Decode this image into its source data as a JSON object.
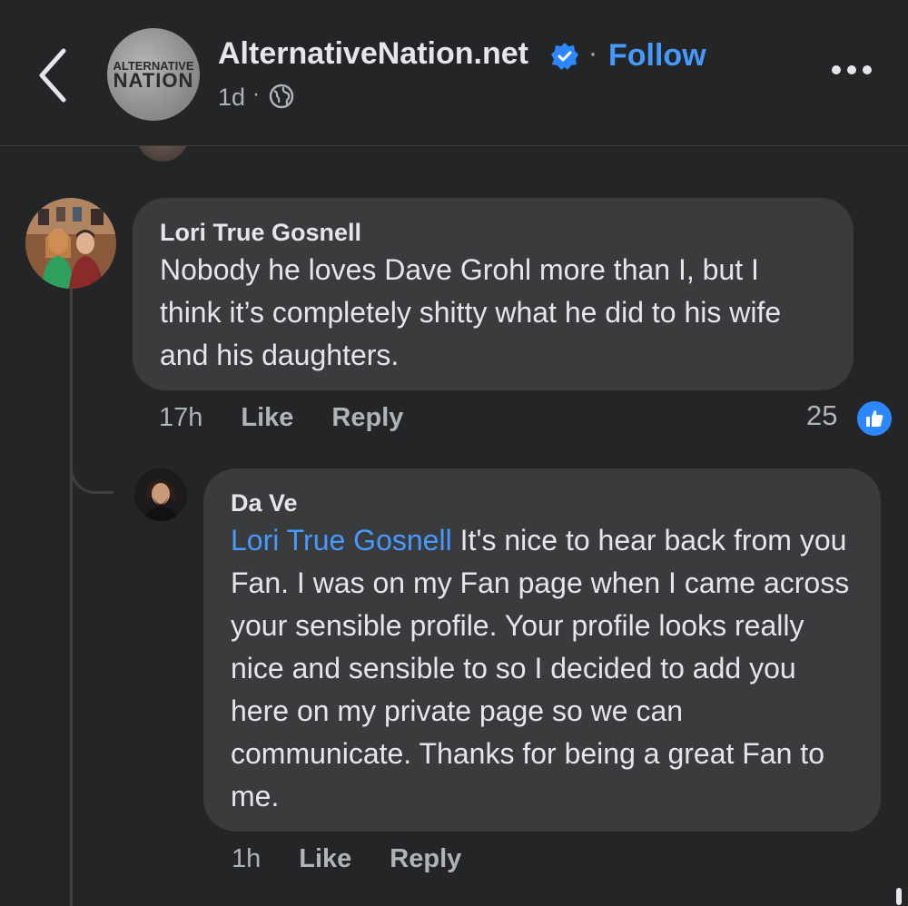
{
  "header": {
    "page_name": "AlternativeNation.net",
    "separator": "·",
    "follow_label": "Follow",
    "time": "1d",
    "meta_separator": "·",
    "logo_line1": "ALTERNATIVE",
    "logo_line2": "NATION",
    "icons": [
      "back-chevron-icon",
      "verified-badge-icon",
      "globe-icon",
      "more-options-icon"
    ]
  },
  "comments": [
    {
      "author": "Lori True Gosnell",
      "text": "Nobody he loves Dave Grohl more than I, but I think it’s completely shitty what he did to his wife and his daughters.",
      "time": "17h",
      "like_label": "Like",
      "reply_label": "Reply",
      "reaction_count": "25",
      "reaction_icon": "thumbs-up-icon"
    }
  ],
  "replies": [
    {
      "author": "Da Ve",
      "mention": "Lori True Gosnell",
      "text": " It's nice to hear back from you Fan. I was on my Fan page when I came across your sensible profile. Your profile looks really nice and sensible to so I decided to add you here on my private page so we can communicate. Thanks for being a great Fan to me.",
      "time": "1h",
      "like_label": "Like",
      "reply_label": "Reply"
    }
  ],
  "colors": {
    "background": "#242526",
    "bubble": "#3a3b3c",
    "accent": "#4599ff",
    "like_badge": "#2d88ff"
  }
}
